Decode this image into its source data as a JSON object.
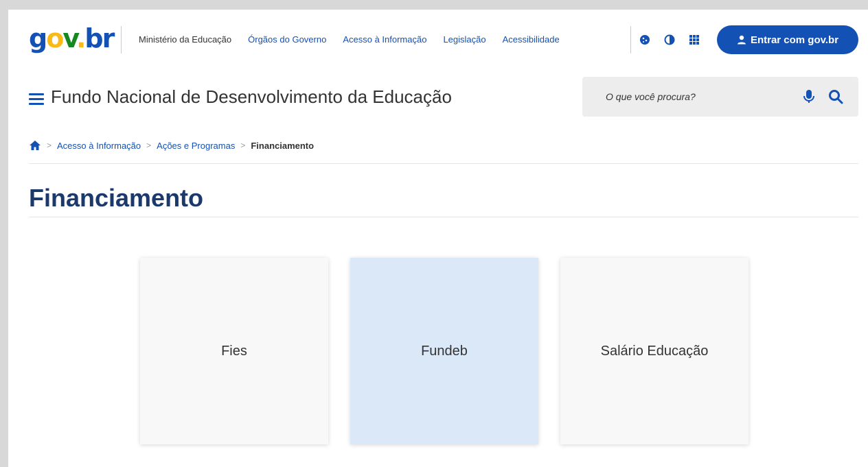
{
  "logo": {
    "g": "g",
    "o": "o",
    "v": "v",
    "dot": ".",
    "br": "br"
  },
  "top_links": [
    "Ministério da Educação",
    "Órgãos do Governo",
    "Acesso à Informação",
    "Legislação",
    "Acessibilidade"
  ],
  "top_icons": [
    "cookie-icon",
    "contrast-icon",
    "apps-grid-icon"
  ],
  "login": {
    "label": "Entrar com gov.br",
    "icon": "user-icon"
  },
  "header": {
    "site_title": "Fundo Nacional de Desenvolvimento da Educação",
    "menu_icon": "hamburger-menu-icon"
  },
  "search": {
    "placeholder": "O que você procura?",
    "mic_icon": "microphone-icon",
    "search_icon": "search-icon"
  },
  "breadcrumb": {
    "home_icon": "home-icon",
    "items": [
      "Acesso à Informação",
      "Ações e Programas"
    ],
    "current": "Financiamento",
    "separator": ">"
  },
  "page_title": "Financiamento",
  "cards": [
    {
      "label": "Fies",
      "active": false
    },
    {
      "label": "Fundeb",
      "active": true
    },
    {
      "label": "Salário Educação",
      "active": false
    }
  ],
  "colors": {
    "primary": "#1351b4",
    "title": "#1b3a6b",
    "card_active": "#dbe8f8",
    "card": "#f8f8f8"
  }
}
